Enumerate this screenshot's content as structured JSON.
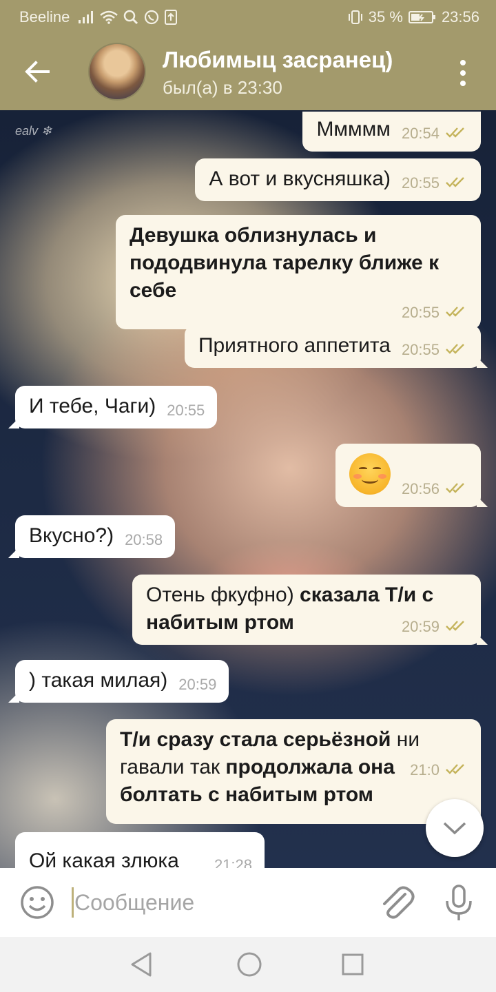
{
  "status_bar": {
    "carrier": "Beeline",
    "battery": "35 %",
    "time": "23:56",
    "icons": [
      "signal-icon",
      "wifi-icon",
      "search-icon",
      "whatsapp-icon",
      "upload-icon",
      "vibrate-icon",
      "battery-icon"
    ]
  },
  "header": {
    "title": "Любимыц засранец)",
    "status": "был(а) в 23:30",
    "accent_color": "#a39a6c"
  },
  "chat": {
    "background_watermark": "ealv ❄",
    "messages": [
      {
        "id": "m1",
        "dir": "out",
        "parts": [
          {
            "t": "Ммммм",
            "b": false
          }
        ],
        "time": "20:54",
        "read": true
      },
      {
        "id": "m2",
        "dir": "out",
        "parts": [
          {
            "t": "А вот и вкусняшка)",
            "b": false
          }
        ],
        "time": "20:55",
        "read": true
      },
      {
        "id": "m3",
        "dir": "out",
        "parts": [
          {
            "t": "Девушка облизнулась и пододвинула тарелку ближе к себе",
            "b": true
          }
        ],
        "time": "20:55",
        "read": true
      },
      {
        "id": "m4",
        "dir": "out",
        "parts": [
          {
            "t": "Приятного аппетита",
            "b": false
          }
        ],
        "time": "20:55",
        "read": true
      },
      {
        "id": "m5",
        "dir": "in",
        "parts": [
          {
            "t": "И тебе, Чаги)",
            "b": false
          }
        ],
        "time": "20:55"
      },
      {
        "id": "m6",
        "dir": "out",
        "emoji": "☺️",
        "time": "20:56",
        "read": true
      },
      {
        "id": "m7",
        "dir": "in",
        "parts": [
          {
            "t": "Вкусно?)",
            "b": false
          }
        ],
        "time": "20:58"
      },
      {
        "id": "m8",
        "dir": "out",
        "parts": [
          {
            "t": "Отень фкуфно) ",
            "b": false
          },
          {
            "t": "сказала Т/и с набитым ртом",
            "b": true
          }
        ],
        "time": "20:59",
        "read": true
      },
      {
        "id": "m9",
        "dir": "in",
        "parts": [
          {
            "t": ") такая милая)",
            "b": false
          }
        ],
        "time": "20:59"
      },
      {
        "id": "m10",
        "dir": "out",
        "parts": [
          {
            "t": "Т/и сразу стала серьёзной",
            "b": true
          },
          {
            "t": " ни гавали так ",
            "b": false
          },
          {
            "t": "продолжала она болтать с набитым ртом",
            "b": true
          }
        ],
        "time": "21:0",
        "read": true
      },
      {
        "id": "m11",
        "dir": "in",
        "parts": [
          {
            "t": "Ой какая злюка",
            "b": false
          }
        ],
        "time": "21:28"
      }
    ]
  },
  "composer": {
    "placeholder": "Сообщение"
  },
  "colors": {
    "outgoing_bubble": "#fbf6e9",
    "incoming_bubble": "#ffffff",
    "read_check": "#c4b35a"
  }
}
